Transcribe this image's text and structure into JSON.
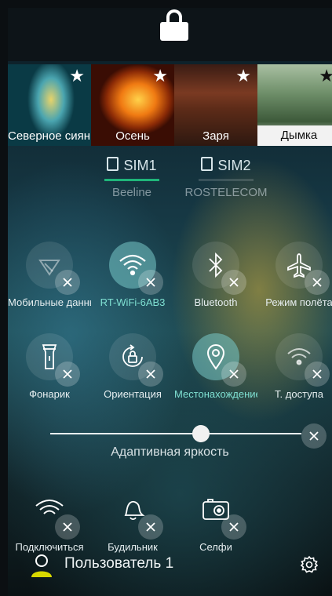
{
  "themes": [
    {
      "label": "Северное сияние",
      "star": "★"
    },
    {
      "label": "Осень",
      "star": "★"
    },
    {
      "label": "Заря",
      "star": "★"
    },
    {
      "label": "Дымка",
      "star": "★"
    }
  ],
  "sims": [
    {
      "name": "SIM1",
      "operator": "Beeline"
    },
    {
      "name": "SIM2",
      "operator": "ROSTELECOM"
    }
  ],
  "toggles": [
    {
      "label": "Мобильные данные",
      "on": false
    },
    {
      "label": "RT-WiFi-6AB3",
      "on": true
    },
    {
      "label": "Bluetooth",
      "on": false
    },
    {
      "label": "Режим полёта",
      "on": false
    },
    {
      "label": "Фонарик",
      "on": false
    },
    {
      "label": "Ориентация",
      "on": false
    },
    {
      "label": "Местонахождение",
      "on": true
    },
    {
      "label": "Т. доступа",
      "on": false
    },
    {
      "label": "Подключиться",
      "on": false
    },
    {
      "label": "Будильник",
      "on": false
    },
    {
      "label": "Селфи",
      "on": false
    }
  ],
  "brightness": {
    "label": "Адаптивная яркость",
    "level": 0.6
  },
  "user": {
    "name": "Пользователь 1"
  },
  "colors": {
    "accent": "#1fb57a",
    "on_text": "#7fe0d2",
    "avatar": "#d8d800"
  }
}
